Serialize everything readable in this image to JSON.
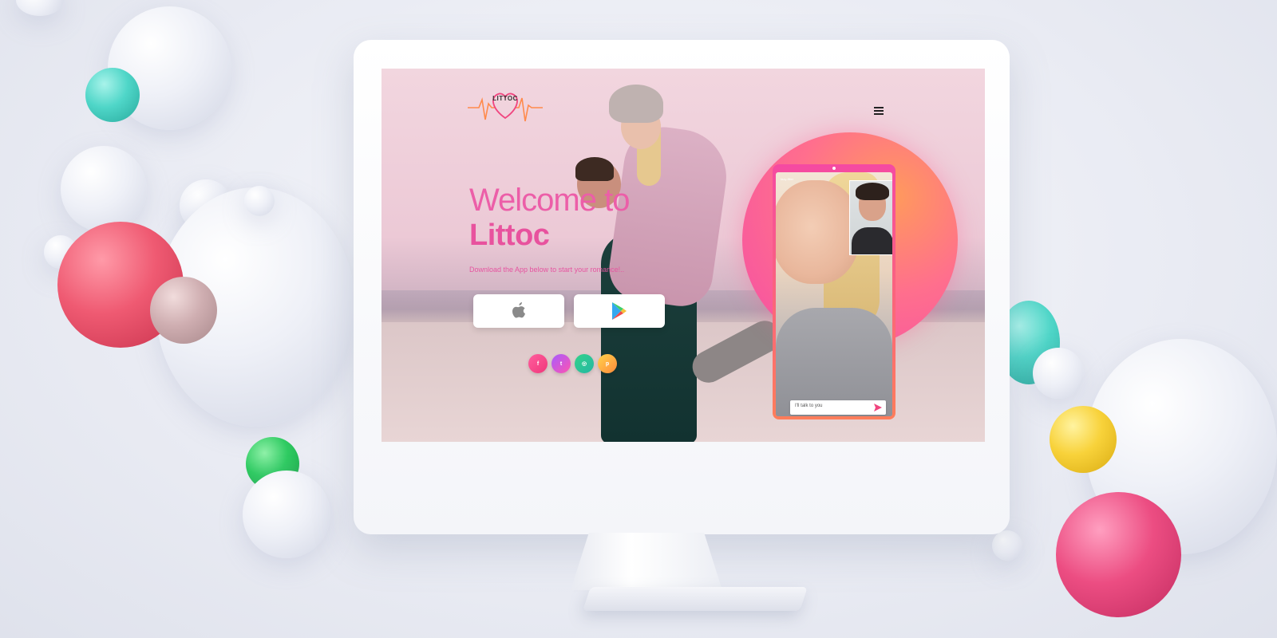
{
  "site": {
    "logo_text": "LITTOC",
    "welcome_line": "Welcome to",
    "brand_line": "Littoc",
    "tagline": "Download the App below to start your romance!.."
  },
  "store_buttons": [
    {
      "icon": "apple-icon"
    },
    {
      "icon": "google-play-icon"
    }
  ],
  "social": [
    {
      "icon": "facebook-icon",
      "glyph": "f"
    },
    {
      "icon": "twitter-icon",
      "glyph": "t"
    },
    {
      "icon": "instagram-icon",
      "glyph": "◎"
    },
    {
      "icon": "pinterest-icon",
      "glyph": "p"
    }
  ],
  "phone": {
    "signal_text": "fazy-filter",
    "message_value": "I'll talk to you"
  },
  "colors": {
    "brand_pink": "#e8529e",
    "gradient_orange": "#ff9a5c"
  }
}
